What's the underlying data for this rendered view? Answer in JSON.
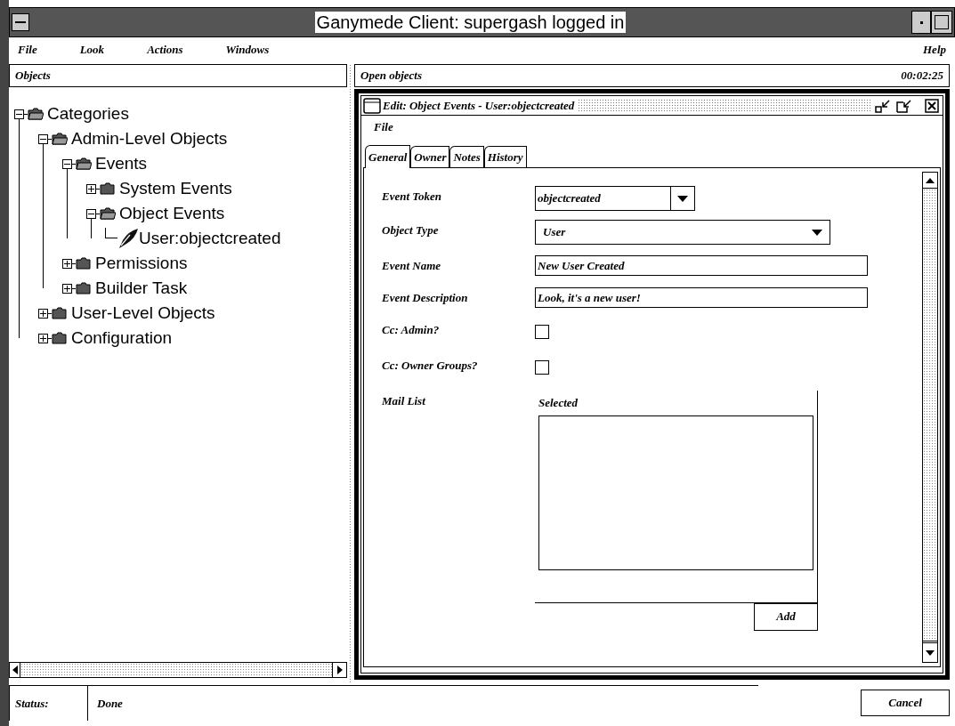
{
  "window": {
    "title": "Ganymede Client: supergash logged in"
  },
  "menu": [
    {
      "label": "File"
    },
    {
      "label": "Look"
    },
    {
      "label": "Actions"
    },
    {
      "label": "Windows"
    }
  ],
  "help_menu": {
    "label": "Help"
  },
  "objects_panel": {
    "title": "Objects",
    "tree": [
      {
        "label": "Categories",
        "kind": "folder",
        "expanded": true,
        "children": [
          {
            "label": "Admin-Level Objects",
            "kind": "folder",
            "expanded": true,
            "children": [
              {
                "label": "Events",
                "kind": "folder",
                "expanded": true,
                "children": [
                  {
                    "label": "System Events",
                    "kind": "folder",
                    "expanded": false
                  },
                  {
                    "label": "Object Events",
                    "kind": "folder",
                    "expanded": true,
                    "children": [
                      {
                        "label": "User:objectcreated",
                        "kind": "object"
                      }
                    ]
                  }
                ]
              },
              {
                "label": "Permissions",
                "kind": "folder",
                "expanded": false
              },
              {
                "label": "Builder Task",
                "kind": "folder",
                "expanded": false
              }
            ]
          },
          {
            "label": "User-Level Objects",
            "kind": "folder",
            "expanded": false
          },
          {
            "label": "Configuration",
            "kind": "folder",
            "expanded": false
          }
        ]
      }
    ]
  },
  "open_objects_panel": {
    "title": "Open objects",
    "timer": "00:02:25"
  },
  "edit_window": {
    "title": "Edit: Object Events - User:objectcreated",
    "menu": [
      "File"
    ],
    "tabs": [
      {
        "label": "General",
        "selected": true
      },
      {
        "label": "Owner",
        "selected": false
      },
      {
        "label": "Notes",
        "selected": false
      },
      {
        "label": "History",
        "selected": false
      }
    ],
    "fields": [
      {
        "kind": "combo",
        "label": "Event Token",
        "value": "objectcreated"
      },
      {
        "kind": "select",
        "label": "Object Type",
        "value": "User"
      },
      {
        "kind": "text",
        "label": "Event Name",
        "value": "New User Created"
      },
      {
        "kind": "text",
        "label": "Event Description",
        "value": "Look, it's a new user!"
      },
      {
        "kind": "checkbox",
        "label": "Cc: Admin?",
        "checked": false
      },
      {
        "kind": "checkbox",
        "label": "Cc: Owner Groups?",
        "checked": false
      },
      {
        "kind": "list",
        "label": "Mail List",
        "heading": "Selected",
        "button": "Add"
      }
    ]
  },
  "status_bar": {
    "label": "Status:",
    "text": "Done",
    "button": "Cancel"
  }
}
